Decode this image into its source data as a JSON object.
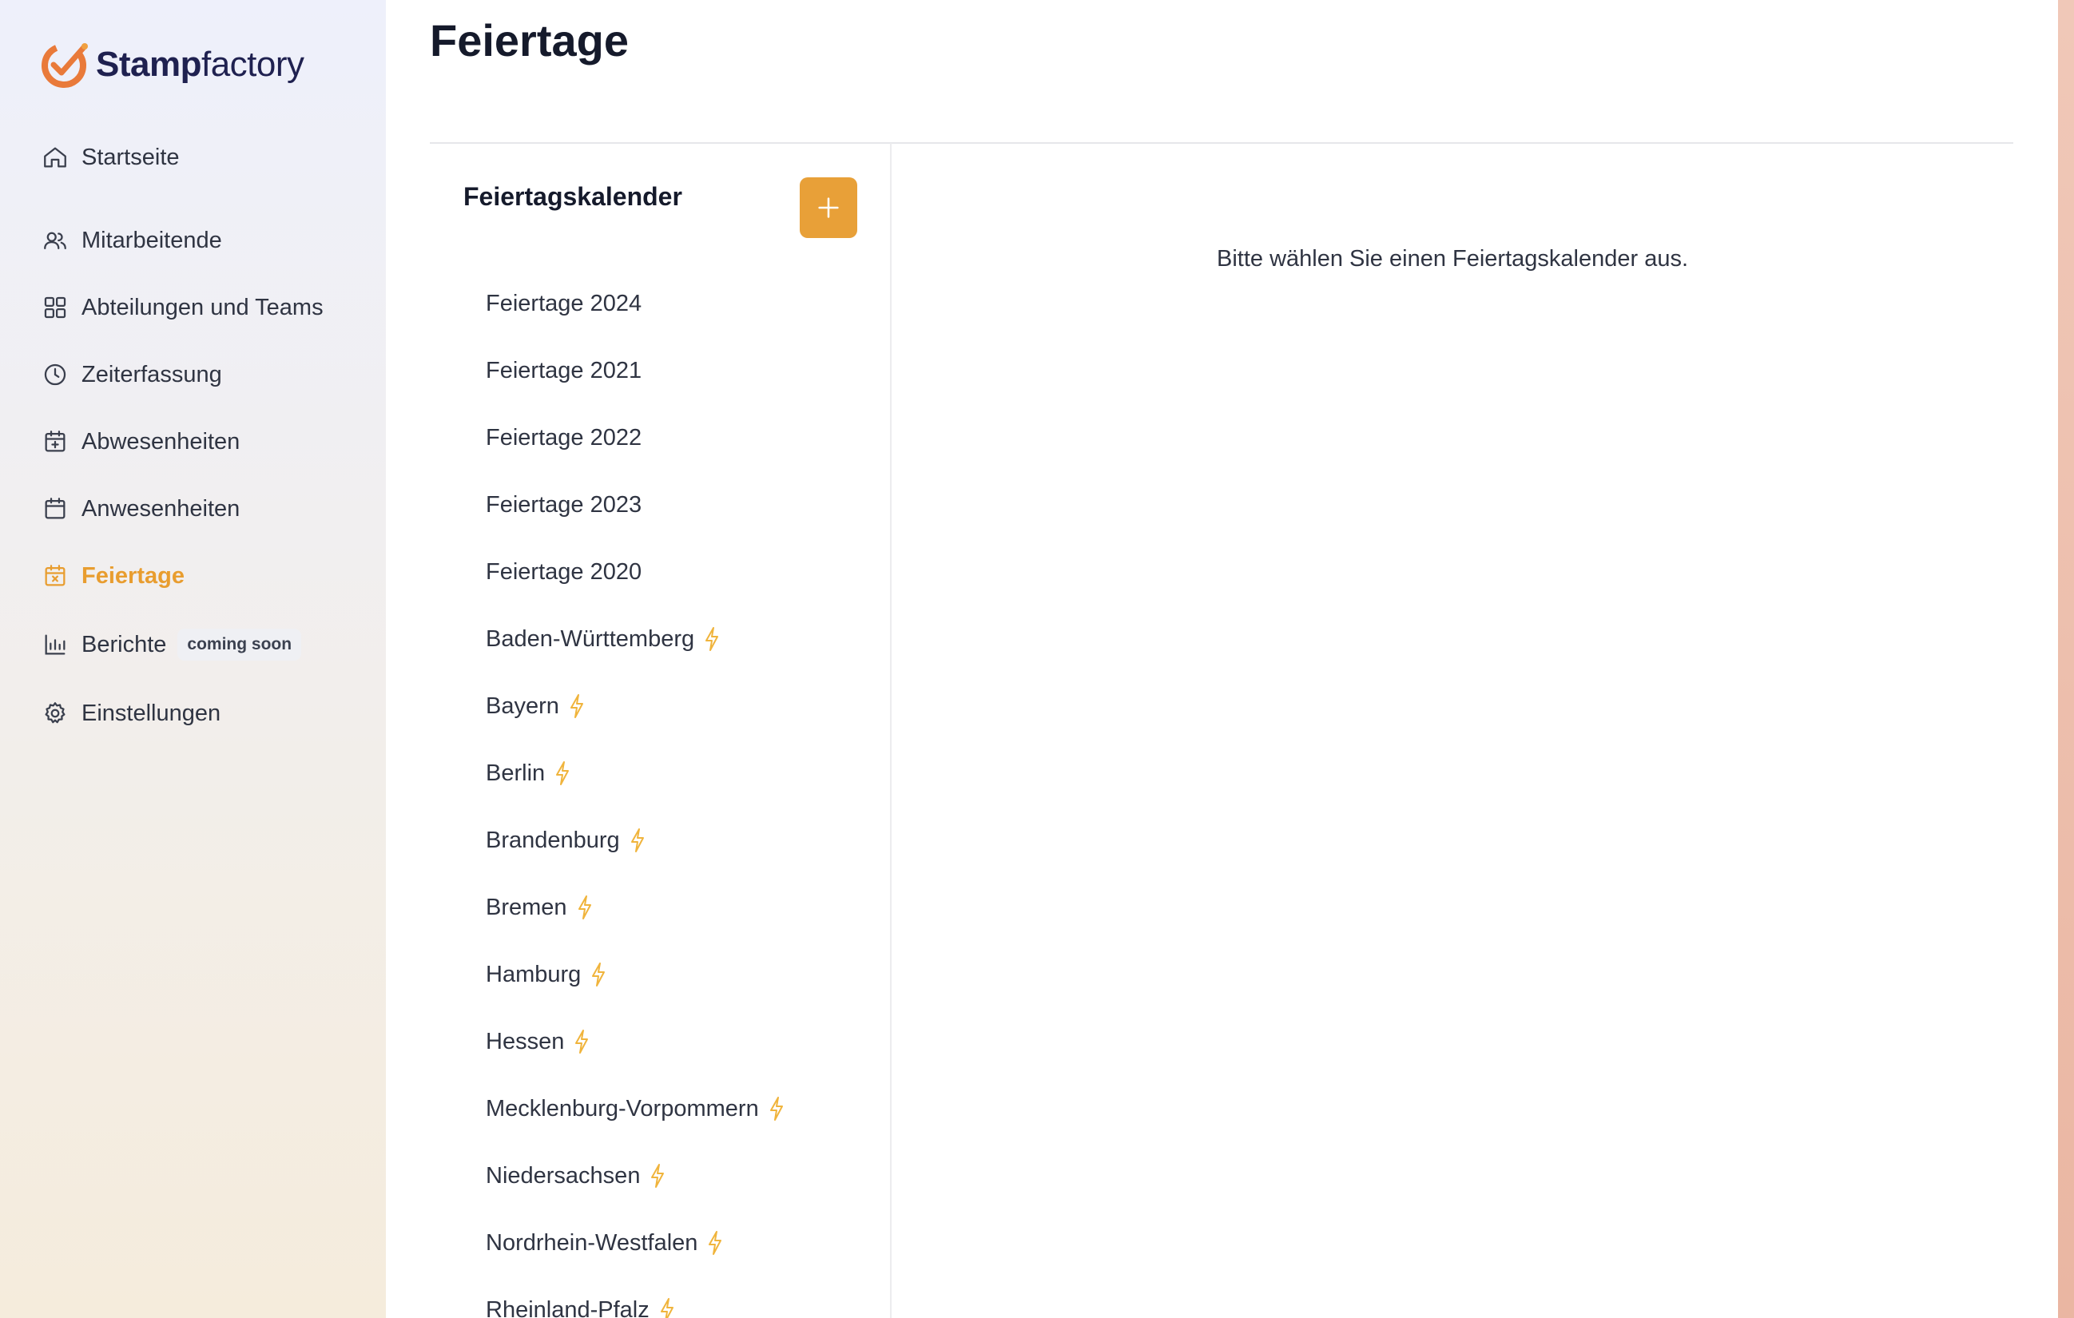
{
  "brand": {
    "name_bold": "Stamp",
    "name_light": "factory",
    "accent": "#e89d2f"
  },
  "nav": {
    "items": [
      {
        "label": "Startseite",
        "icon": "home-icon"
      },
      {
        "label": "Mitarbeitende",
        "icon": "users-icon"
      },
      {
        "label": "Abteilungen und Teams",
        "icon": "grid-icon"
      },
      {
        "label": "Zeiterfassung",
        "icon": "clock-icon"
      },
      {
        "label": "Abwesenheiten",
        "icon": "calendar-plus-icon"
      },
      {
        "label": "Anwesenheiten",
        "icon": "calendar-icon"
      },
      {
        "label": "Feiertage",
        "icon": "calendar-x-icon",
        "active": true
      },
      {
        "label": "Berichte",
        "icon": "bar-chart-icon",
        "badge": "coming soon"
      },
      {
        "label": "Einstellungen",
        "icon": "gear-icon"
      }
    ]
  },
  "page": {
    "title": "Feiertage"
  },
  "calendars": {
    "heading": "Feiertagskalender",
    "add_icon": "plus-icon",
    "items": [
      {
        "label": "Feiertage 2024",
        "auto": false
      },
      {
        "label": "Feiertage 2021",
        "auto": false
      },
      {
        "label": "Feiertage 2022",
        "auto": false
      },
      {
        "label": "Feiertage 2023",
        "auto": false
      },
      {
        "label": "Feiertage 2020",
        "auto": false
      },
      {
        "label": "Baden-Württemberg",
        "auto": true
      },
      {
        "label": "Bayern",
        "auto": true
      },
      {
        "label": "Berlin",
        "auto": true
      },
      {
        "label": "Brandenburg",
        "auto": true
      },
      {
        "label": "Bremen",
        "auto": true
      },
      {
        "label": "Hamburg",
        "auto": true
      },
      {
        "label": "Hessen",
        "auto": true
      },
      {
        "label": "Mecklenburg-Vorpommern",
        "auto": true
      },
      {
        "label": "Niedersachsen",
        "auto": true
      },
      {
        "label": "Nordrhein-Westfalen",
        "auto": true
      },
      {
        "label": "Rheinland-Pfalz",
        "auto": true
      }
    ]
  },
  "detail": {
    "empty_message": "Bitte wählen Sie einen Feiertagskalender aus."
  }
}
